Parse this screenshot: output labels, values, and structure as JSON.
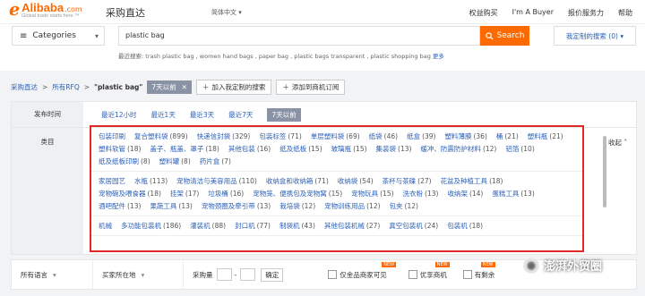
{
  "topbar": {
    "logo_brand": "Alibaba",
    "logo_com": ".com",
    "logo_tagline": "Global trade starts here.™",
    "site_name": "采购直达",
    "language": "简体中文",
    "links": [
      "权益购买",
      "I'm A Buyer",
      "报价服务力",
      "帮助"
    ]
  },
  "search": {
    "category_label": "Categories",
    "query": "plastic bag",
    "button_label": "Search",
    "custom_search_label": "我定制的搜索 (0)",
    "recent_label": "最近搜索:",
    "recent_items": "trash plastic bag , women hand bags , paper bag , plastic bags transparent , plastic shopping bag",
    "more": "更多"
  },
  "breadcrumb": {
    "items": [
      "采购直达",
      "所有RFQ"
    ],
    "keyword": "\"plastic bag\"",
    "time_chip": "7天以前",
    "add_custom_search": "加入我定制的搜索",
    "add_subscription": "添加到商机订阅"
  },
  "filters": {
    "time_label": "发布时间",
    "time_options": [
      "最近12小时",
      "最近1天",
      "最近3天",
      "最近7天",
      "7天以前"
    ],
    "category_label": "类目",
    "collapse_label": "收起",
    "groups": [
      {
        "head": "包装印刷",
        "items": [
          [
            "复合塑料袋",
            "(899)"
          ],
          [
            "快递信封袋",
            "(329)"
          ],
          [
            "包装标签",
            "(71)"
          ],
          [
            "单层塑料袋",
            "(69)"
          ],
          [
            "纸袋",
            "(46)"
          ],
          [
            "纸盒",
            "(39)"
          ],
          [
            "塑料薄膜",
            "(36)"
          ],
          [
            "桶",
            "(21)"
          ],
          [
            "塑料瓶",
            "(21)"
          ],
          [
            "塑料软管",
            "(18)"
          ],
          [
            "盖子、瓶盖、罩子",
            "(18)"
          ],
          [
            "其他包装",
            "(16)"
          ],
          [
            "纸及纸板",
            "(15)"
          ],
          [
            "玻璃瓶",
            "(15)"
          ],
          [
            "集装袋",
            "(13)"
          ],
          [
            "缓冲、防震防护材料",
            "(12)"
          ],
          [
            "铝箔",
            "(10)"
          ],
          [
            "纸及纸板印刷",
            "(8)"
          ],
          [
            "塑料罐",
            "(8)"
          ],
          [
            "药片盒",
            "(7)"
          ]
        ]
      },
      {
        "head": "家居园艺",
        "items": [
          [
            "水瓶",
            "(113)"
          ],
          [
            "宠物清洁与美容用品",
            "(110)"
          ],
          [
            "收纳盒和收纳箱",
            "(71)"
          ],
          [
            "收纳袋",
            "(54)"
          ],
          [
            "茶杯与茶碟",
            "(27)"
          ],
          [
            "花盆及种植工具",
            "(18)"
          ],
          [
            "宠物碗及喂食器",
            "(18)"
          ],
          [
            "挂架",
            "(17)"
          ],
          [
            "垃圾桶",
            "(16)"
          ],
          [
            "宠物笼、便携包及宠物窝",
            "(15)"
          ],
          [
            "宠物玩具",
            "(15)"
          ],
          [
            "洗衣粉",
            "(13)"
          ],
          [
            "收纳架",
            "(14)"
          ],
          [
            "蛋糕工具",
            "(13)"
          ],
          [
            "酒吧配件",
            "(13)"
          ],
          [
            "果蔬工具",
            "(13)"
          ],
          [
            "宠物颈圈及牵引带",
            "(13)"
          ],
          [
            "栽培袋",
            "(12)"
          ],
          [
            "宠物训练用品",
            "(12)"
          ],
          [
            "包夹",
            "(12)"
          ]
        ]
      },
      {
        "head": "机械",
        "items": [
          [
            "多功能包装机",
            "(186)"
          ],
          [
            "灌装机",
            "(88)"
          ],
          [
            "封口机",
            "(77)"
          ],
          [
            "制袋机",
            "(43)"
          ],
          [
            "其他包装机械",
            "(27)"
          ],
          [
            "真空包装机",
            "(24)"
          ],
          [
            "包装机",
            "(18)"
          ]
        ]
      }
    ]
  },
  "bottombar": {
    "language_select": "所有语言",
    "location_select": "买家所在地",
    "quantity_label": "采购量",
    "quantity_dash": "-",
    "ok_label": "确定",
    "option1": "仅金品商家可见",
    "option2": "优享商机",
    "option3": "有剩余",
    "hot1": "NEW",
    "hot2": "NEW",
    "hot3": "NEW"
  },
  "watermark": {
    "text": "澎湃外贸圈"
  }
}
